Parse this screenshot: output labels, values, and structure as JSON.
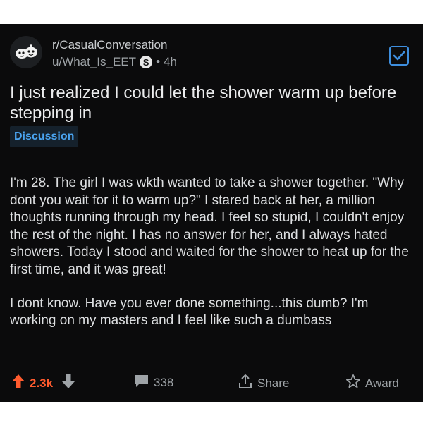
{
  "post": {
    "subreddit": "r/CasualConversation",
    "username": "u/What_Is_EET",
    "user_badge": "S",
    "separator": "•",
    "age": "4h",
    "title": "I just realized I could let the shower warm up before stepping in",
    "flair": "Discussion",
    "paragraphs": [
      "I'm 28. The girl I was wkth wanted to take a shower together. \"Why dont you wait for it to warm up?\"  I stared back at her, a million thoughts running through my head. I feel so stupid, I couldn't enjoy the rest of the night. I has no answer for her, and I always hated showers. Today I stood and waited for the shower to heat up for the first time, and it was great!",
      "I dont know. Have you ever done something...this dumb? I'm working on my masters and I feel like such a dumbass"
    ]
  },
  "actions": {
    "upvotes": "2.3k",
    "comments": "338",
    "share_label": "Share",
    "award_label": "Award"
  },
  "colors": {
    "background": "#0b0b0c",
    "upvote": "#ff5b2e",
    "accent": "#3e8ede",
    "flair_text": "#4aa3ef"
  },
  "icons": [
    "subreddit-avatar-icon",
    "checkbox-icon",
    "upvote-icon",
    "downvote-icon",
    "comment-icon",
    "share-icon",
    "award-icon"
  ]
}
